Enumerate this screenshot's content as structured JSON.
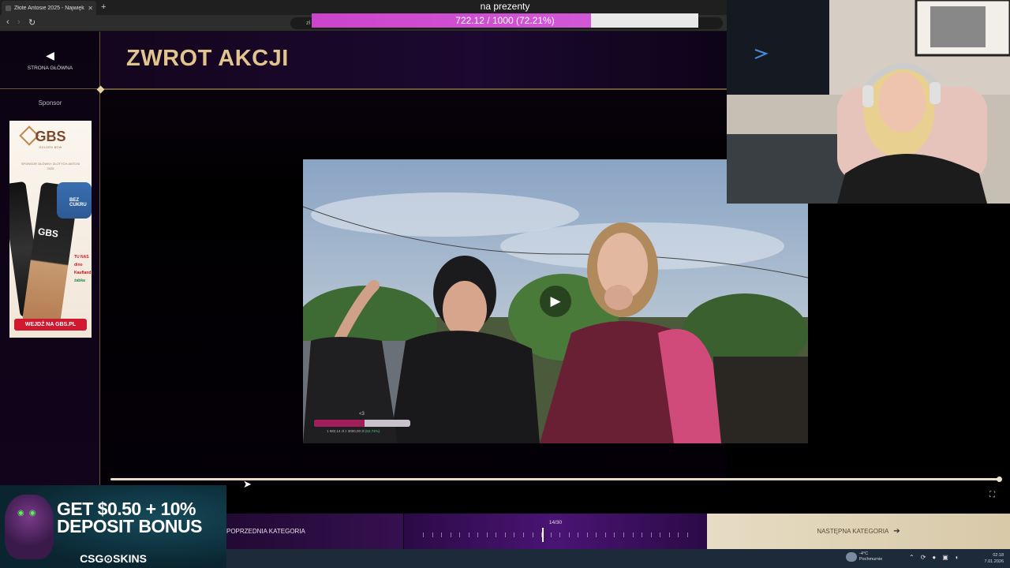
{
  "browser": {
    "tab_title": "Złote Antosie 2025 - Najwięk",
    "tab_close": "✕",
    "new_tab": "+",
    "back": "‹",
    "forward": "›",
    "reload": "↻",
    "address_text": "zł"
  },
  "goal_overlay": {
    "title": "na prezenty",
    "text": "722.12 / 1000 (72.21%)",
    "progress_percent": 72.21,
    "fill_color": "#cc44cc"
  },
  "sidebar": {
    "home_label": "STRONA GŁÓWNA",
    "home_icon": "arrow-left-icon",
    "sponsor_label": "Sponsor"
  },
  "sponsor_ad": {
    "logo": "GBS",
    "tagline": "GOLDEN BOW",
    "sponsor_text": "SPONSOR GŁÓWNY ZŁOTYCH ANTOSI 2025",
    "can_label": "GBS",
    "bez_cukru": "BEZ CUKRU",
    "stores": [
      "TU NAS",
      "dino",
      "Kaufland",
      "żabka"
    ],
    "cta": "WEJDŹ NA GBS.PL"
  },
  "header": {
    "title": "ZWROT AKCJI"
  },
  "video": {
    "play_icon": "play-icon",
    "emote": "<3",
    "goal_text": "1 582,14 zł z 3000,00 zł",
    "goal_pct": "(52.74%)",
    "goal_percent": 52.74
  },
  "nav": {
    "prev_label": "POPRZEDNIA KATEGORIA",
    "progress_label": "14/30",
    "current": 14,
    "total": 30,
    "next_label": "NASTĘPNA KATEGORIA",
    "next_icon": "arrow-right-icon",
    "fullscreen_icon": "fullscreen-icon"
  },
  "csgo_ad": {
    "line1": "GET $0.50 + 10%",
    "line2": "DEPOSIT BONUS",
    "brand": "CSG⊙SKINS"
  },
  "taskbar": {
    "weather_temp": "-4°C",
    "weather_desc": "Pochmurnie",
    "time": "02:18",
    "date": "7.01.2026"
  }
}
